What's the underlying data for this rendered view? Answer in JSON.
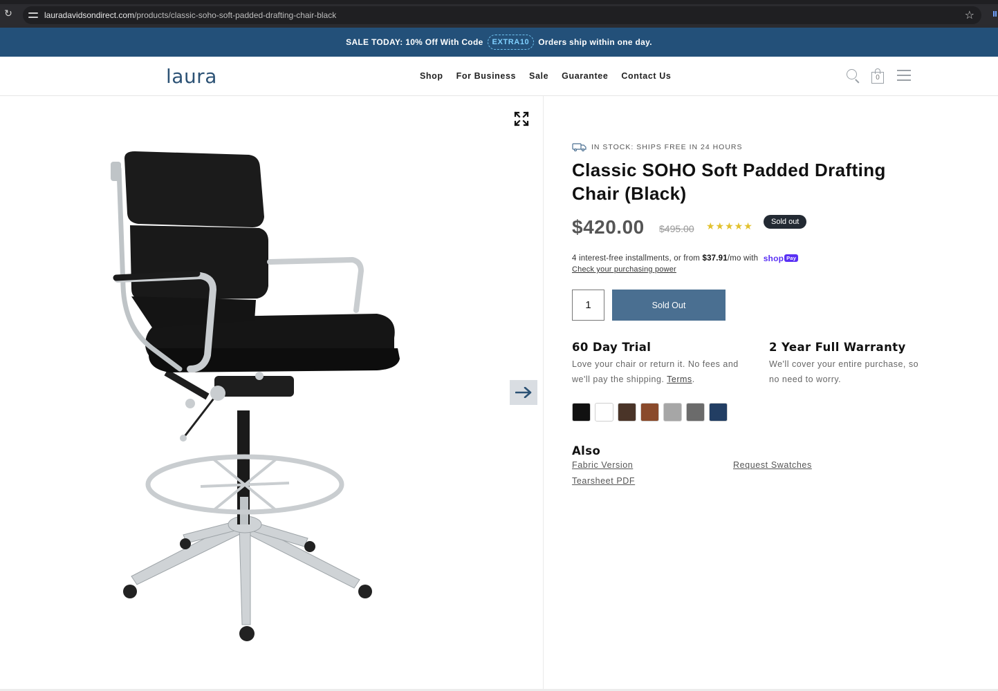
{
  "browser": {
    "url_host": "lauradavidsondirect.com",
    "url_path": "/products/classic-soho-soft-padded-drafting-chair-black"
  },
  "announcement": {
    "prefix": "SALE TODAY: 10% Off With Code",
    "code": "EXTRA10",
    "suffix": "Orders ship within one day."
  },
  "header": {
    "logo": "laura",
    "nav": [
      "Shop",
      "For Business",
      "Sale",
      "Guarantee",
      "Contact Us"
    ],
    "cart_count": "0",
    "icons": [
      "search-icon",
      "shopping-bag-icon",
      "hamburger-menu-icon"
    ]
  },
  "gallery": {
    "icons": [
      "expand-icon",
      "arrow-right-icon"
    ]
  },
  "product": {
    "stock": "IN STOCK: SHIPS FREE IN 24 HOURS",
    "title": "Classic SOHO Soft Padded Drafting Chair (Black)",
    "price": "$420.00",
    "compare_price": "$495.00",
    "stars": "★★★★★",
    "badge": "Sold out",
    "installments_prefix": "4 interest-free installments, or from",
    "installments_amount": "$37.91",
    "installments_suffix": "/mo with",
    "shoppay_label": "shop",
    "shoppay_pay": "Pay",
    "check_link": "Check your purchasing power",
    "quantity": "1",
    "buy_button": "Sold Out",
    "perks": [
      {
        "title": "60 Day Trial",
        "text": "Love your chair or return it. No fees and we'll pay the shipping.",
        "link": "Terms"
      },
      {
        "title": "2 Year Full Warranty",
        "text": "We'll cover your entire purchase, so no need to worry."
      }
    ],
    "swatch_colors": [
      "#111111",
      "#ffffff",
      "#4a3428",
      "#8a4a2b",
      "#a6a6a6",
      "#6b6b6b",
      "#223e63"
    ],
    "also_title": "Also",
    "also_links": [
      "Fabric Version",
      "Request Swatches",
      "Tearsheet PDF"
    ]
  },
  "colors": {
    "announcement_bg": "#235079",
    "button_bg": "#4a6f91",
    "logo": "#2c5275"
  }
}
